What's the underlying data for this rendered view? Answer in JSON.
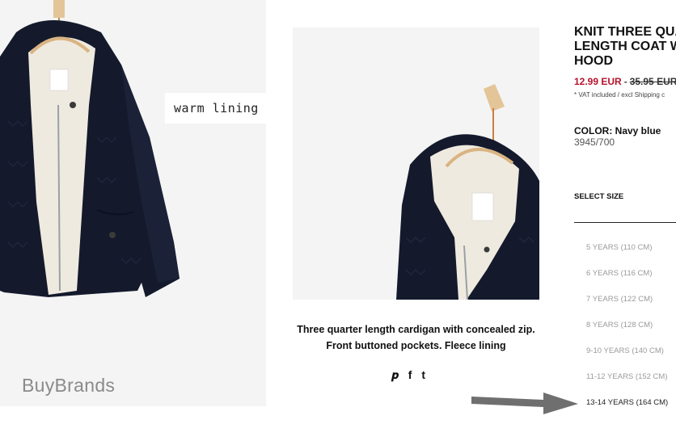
{
  "overlay": {
    "caption": "warm lining",
    "watermark": "BuyBrands"
  },
  "product": {
    "title_lines": [
      "KNIT THREE QUA",
      "LENGTH COAT W",
      "HOOD"
    ],
    "price_new": "12.99 EUR",
    "price_separator": "-",
    "price_old": "35.95 EUR",
    "vat_note": "* VAT included / excl Shipping c",
    "color_label": "COLOR: Navy blue",
    "reference": "3945/700",
    "select_size_label": "SELECT SIZE",
    "sizes": [
      "5 YEARS (110 CM)",
      "6 YEARS (116 CM)",
      "7 YEARS (122 CM)",
      "8 YEARS (128 CM)",
      "9-10 YEARS (140 CM)",
      "11-12 YEARS (152 CM)",
      "13-14 YEARS (164 CM)"
    ],
    "highlighted_size_index": 6
  },
  "description": {
    "line1": "Three quarter length cardigan with concealed zip.",
    "line2": "Front buttoned pockets. Fleece lining"
  },
  "share": {
    "pinterest": "𝒑",
    "facebook": "f",
    "tumblr": "t"
  },
  "icons": [
    "pinterest-icon",
    "facebook-icon",
    "tumblr-icon",
    "arrow-icon"
  ],
  "colors": {
    "price_red": "#b7132c",
    "coat_navy": "#141a2c",
    "fleece": "#efeadf",
    "hanger_wood": "#d9b483"
  }
}
